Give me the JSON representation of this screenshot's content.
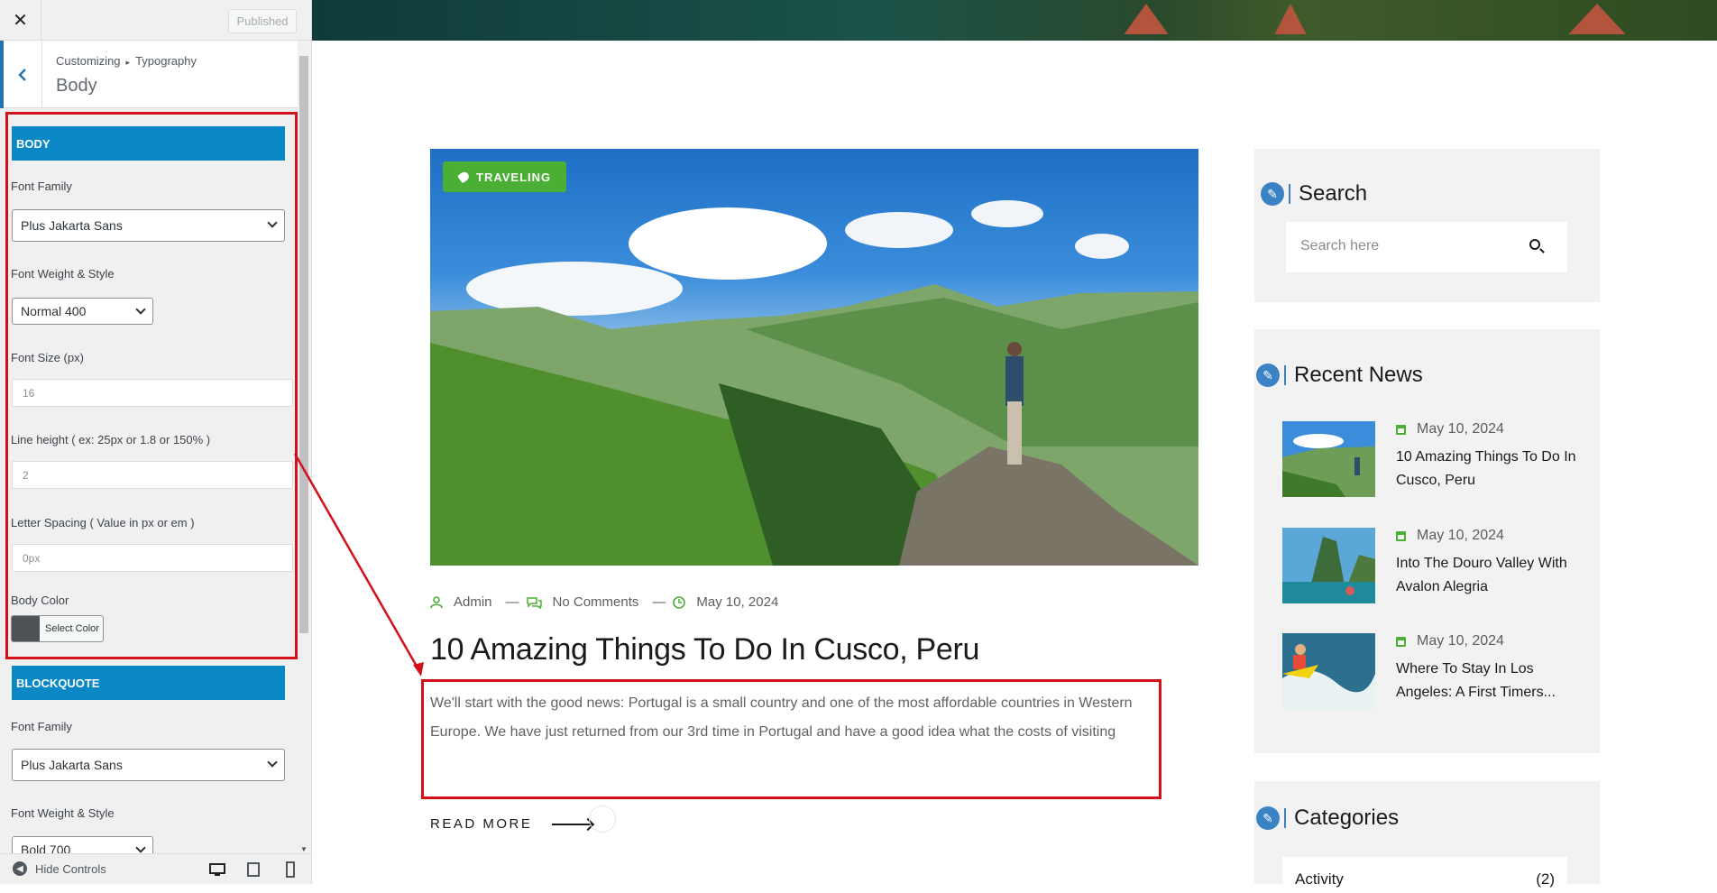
{
  "customizer": {
    "close_label": "✕",
    "publish_label": "Published",
    "breadcrumb_root": "Customizing",
    "breadcrumb_sep": "▸",
    "breadcrumb_section": "Typography",
    "section_title": "Body",
    "groups": {
      "body": {
        "heading": "BODY",
        "font_family_label": "Font Family",
        "font_family_value": "Plus Jakarta Sans",
        "font_weight_label": "Font Weight & Style",
        "font_weight_value": "Normal 400",
        "font_size_label": "Font Size (px)",
        "font_size_value": "16",
        "line_height_label": "Line height ( ex: 25px or 1.8 or 150% )",
        "line_height_value": "2",
        "letter_spacing_label": "Letter Spacing ( Value in px or em )",
        "letter_spacing_value": "0px",
        "color_label": "Body Color",
        "color_button_label": "Select Color",
        "color_value": "#4e5358"
      },
      "blockquote": {
        "heading": "BLOCKQUOTE",
        "font_family_label": "Font Family",
        "font_family_value": "Plus Jakarta Sans",
        "font_weight_label": "Font Weight & Style",
        "font_weight_value": "Bold 700"
      }
    },
    "footer": {
      "hide_controls_label": "Hide Controls",
      "devices": [
        "desktop-icon",
        "tablet-icon",
        "mobile-icon"
      ]
    },
    "accent_color": "#0a88c6"
  },
  "post": {
    "category": "TRAVELING",
    "author": "Admin",
    "comments": "No Comments",
    "date": "May 10, 2024",
    "title": "10 Amazing Things To Do In Cusco, Peru",
    "excerpt": "We'll start with the good news: Portugal is a small country and one of the most affordable countries in Western Europe. We have just returned from our 3rd time in Portugal and have a good idea what the costs of visiting",
    "read_more": "READ MORE"
  },
  "sidebar_widgets": {
    "search": {
      "title": "Search",
      "placeholder": "Search here"
    },
    "recent_news": {
      "title": "Recent News",
      "items": [
        {
          "date": "May 10, 2024",
          "title": "10 Amazing Things To Do In Cusco, Peru"
        },
        {
          "date": "May 10, 2024",
          "title": "Into The Douro Valley With Avalon Alegria"
        },
        {
          "date": "May 10, 2024",
          "title": "Where To Stay In Los Angeles: A First Timers..."
        }
      ]
    },
    "categories": {
      "title": "Categories",
      "first_item": "Activity",
      "first_count": "(2)"
    }
  },
  "colors": {
    "brand_green": "#4caf35",
    "widget_blue": "#3b82c4",
    "annotation_red": "#d4101b"
  }
}
